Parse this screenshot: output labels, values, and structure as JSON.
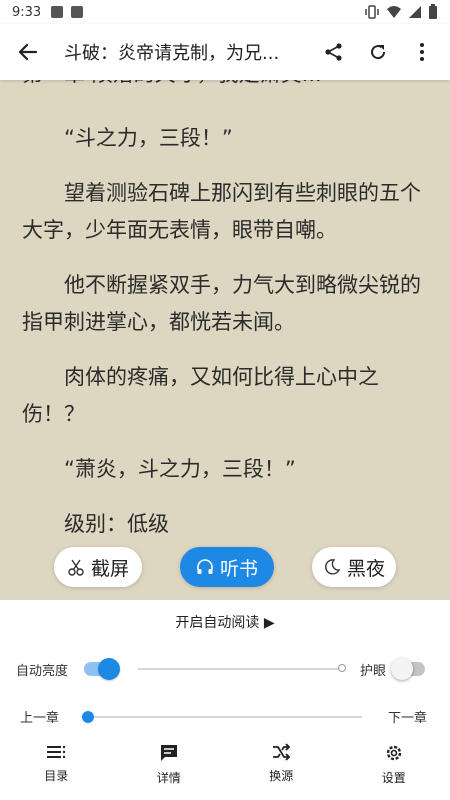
{
  "status_bar": {
    "time": "9:33"
  },
  "app_bar": {
    "title": "斗破：炎帝请克制，为兄..."
  },
  "reader": {
    "partial_top": "第一章 陨落的天才，我是萧炎...",
    "paragraphs": [
      "“斗之力，三段！”",
      "望着测验石碑上那闪到有些刺眼的五个大字，少年面无表情，眼带自嘲。",
      "他不断握紧双手，力气大到略微尖锐的指甲刺进掌心，都恍若未闻。",
      "肉体的疼痛，又如何比得上心中之伤！？",
      "“萧炎，斗之力，三段！”",
      "级别：低级"
    ]
  },
  "floating": {
    "screenshot": "截屏",
    "listen": "听书",
    "night": "黑夜"
  },
  "panel": {
    "auto_read": "开启自动阅读 ▶",
    "auto_brightness": "自动亮度",
    "eye_care": "护眼",
    "prev_chapter": "上一章",
    "next_chapter": "下一章",
    "auto_brightness_on": true,
    "eye_care_on": false,
    "chapter_progress": 0.0
  },
  "bottom_nav": {
    "catalog": "目录",
    "details": "详情",
    "change_source": "换源",
    "settings": "设置"
  },
  "colors": {
    "accent": "#1e88e5",
    "page_bg": "#ddd6c1"
  }
}
